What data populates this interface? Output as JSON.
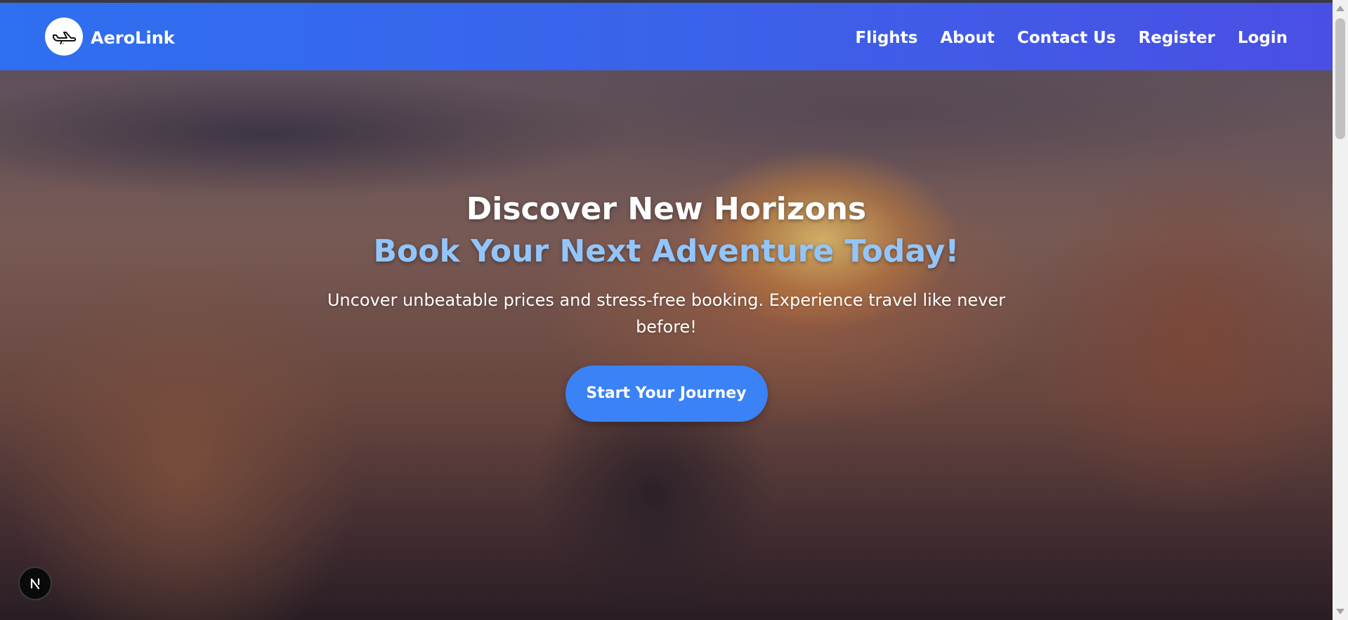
{
  "navbar": {
    "brand": "AeroLink",
    "logo_icon": "airplane-icon",
    "links": [
      "Flights",
      "About",
      "Contact Us",
      "Register",
      "Login"
    ],
    "gradient_start": "#2f6ff0",
    "gradient_end": "#4a4fe3"
  },
  "hero": {
    "headline": "Discover New Horizons",
    "headline_accent": "Book Your Next Adventure Today!",
    "subtext": "Uncover unbeatable prices and stress-free booking. Experience travel like never before!",
    "cta_label": "Start Your Journey",
    "accent_color": "#93c5fd",
    "button_color": "#3b82f6"
  },
  "dev_badge": {
    "label": "N",
    "icon": "nextjs-logo-icon"
  }
}
